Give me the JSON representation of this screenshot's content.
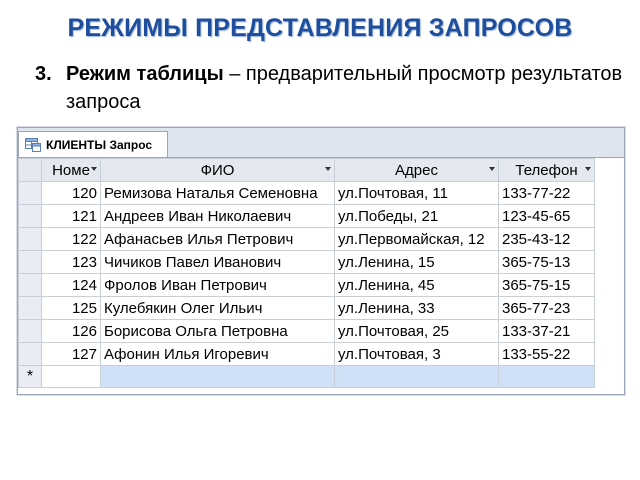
{
  "slide": {
    "title": "РЕЖИМЫ ПРЕДСТАВЛЕНИЯ ЗАПРОСОВ",
    "bullet_number": "3.",
    "bullet_bold": "Режим таблицы",
    "bullet_rest": " – предварительный просмотр результатов запроса"
  },
  "window": {
    "tab_label": "КЛИЕНТЫ Запрос",
    "tab_icon": "query-icon"
  },
  "table": {
    "columns": [
      "Номе",
      "ФИО",
      "Адрес",
      "Телефон"
    ],
    "rows": [
      [
        "120",
        "Ремизова Наталья Семеновна",
        "ул.Почтовая, 11",
        "133-77-22"
      ],
      [
        "121",
        "Андреев Иван Николаевич",
        "ул.Победы, 21",
        "123-45-65"
      ],
      [
        "122",
        "Афанасьев Илья Петрович",
        "ул.Первомайская, 12",
        "235-43-12"
      ],
      [
        "123",
        "Чичиков Павел Иванович",
        "ул.Ленина, 15",
        "365-75-13"
      ],
      [
        "124",
        "Фролов Иван Петрович",
        "ул.Ленина, 45",
        "365-75-15"
      ],
      [
        "125",
        "Кулебякин Олег Ильич",
        "ул.Ленина, 33",
        "365-77-23"
      ],
      [
        "126",
        "Борисова Ольга Петровна",
        "ул.Почтовая, 25",
        "133-37-21"
      ],
      [
        "127",
        "Афонин Илья Игоревич",
        "ул.Почтовая, 3",
        "133-55-22"
      ]
    ],
    "new_record_marker": "*"
  },
  "colors": {
    "title": "#1f4e9c",
    "header_bg": "#e4e8ef",
    "new_row_bg": "#cfe0f7"
  }
}
